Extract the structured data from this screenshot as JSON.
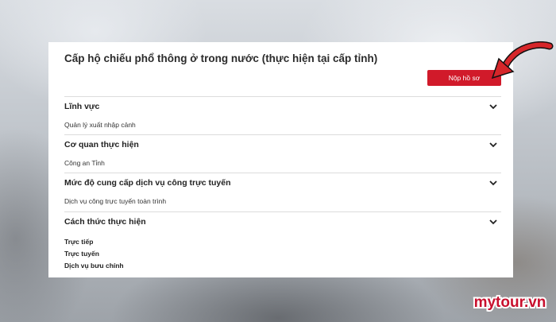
{
  "page": {
    "title": "Cấp hộ chiếu phổ thông ở trong nước (thực hiện tại cấp tỉnh)",
    "submit_label": "Nộp hồ sơ"
  },
  "sections": [
    {
      "title": "Lĩnh vực",
      "value": "Quản lý xuất nhập cảnh"
    },
    {
      "title": "Cơ quan thực hiện",
      "value": "Công an Tỉnh"
    },
    {
      "title": "Mức độ cung cấp dịch vụ công trực tuyến",
      "value": "Dịch vụ công trực tuyến toàn trình"
    },
    {
      "title": "Cách thức thực hiện",
      "items": [
        "Trực tiếp",
        "Trực tuyến",
        "Dịch vụ bưu chính"
      ]
    }
  ],
  "watermark": "mytour.vn",
  "colors": {
    "accent": "#d11a2a",
    "arrow": "#d6262a"
  }
}
